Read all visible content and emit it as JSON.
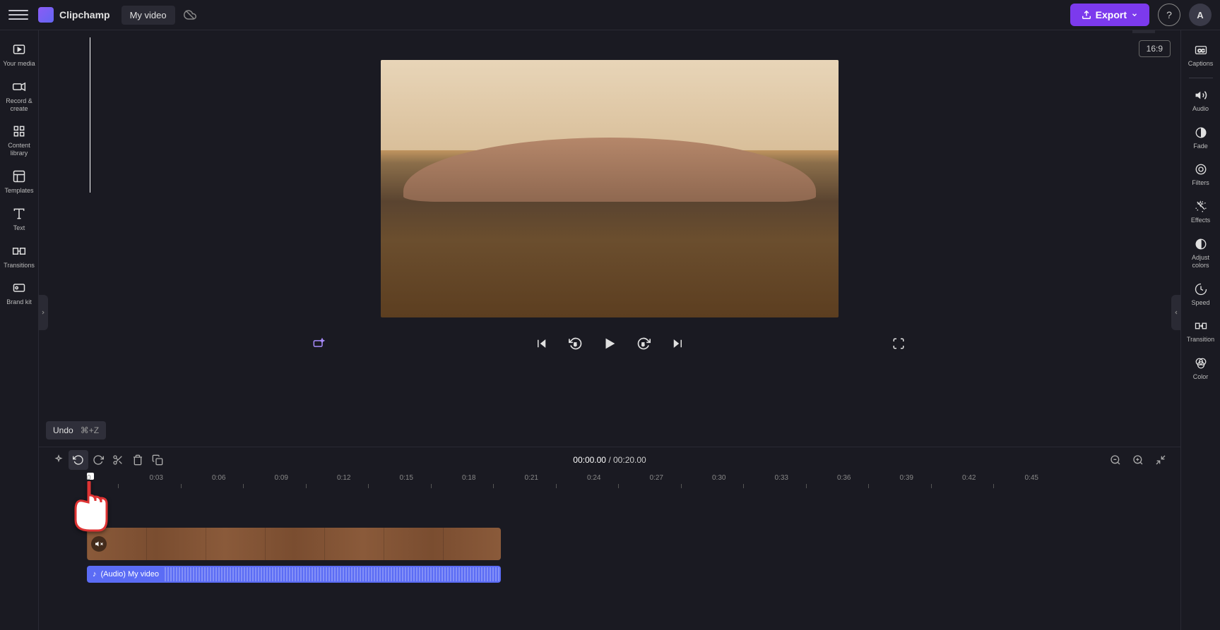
{
  "header": {
    "app_name": "Clipchamp",
    "video_title": "My video",
    "export_label": "Export",
    "avatar_initial": "A",
    "aspect_ratio": "16:9"
  },
  "left_sidebar": {
    "items": [
      {
        "label": "Your media"
      },
      {
        "label": "Record & create"
      },
      {
        "label": "Content library"
      },
      {
        "label": "Templates"
      },
      {
        "label": "Text"
      },
      {
        "label": "Transitions"
      },
      {
        "label": "Brand kit"
      }
    ]
  },
  "right_sidebar": {
    "items": [
      {
        "label": "Captions"
      },
      {
        "label": "Audio"
      },
      {
        "label": "Fade"
      },
      {
        "label": "Filters"
      },
      {
        "label": "Effects"
      },
      {
        "label": "Adjust colors"
      },
      {
        "label": "Speed"
      },
      {
        "label": "Transition"
      },
      {
        "label": "Color"
      }
    ]
  },
  "tooltip": {
    "label": "Undo",
    "shortcut": "⌘+Z"
  },
  "timeline": {
    "current_time": "00:00.00",
    "total_time": "00:20.00",
    "ruler": [
      "0",
      "0:03",
      "0:06",
      "0:09",
      "0:12",
      "0:15",
      "0:18",
      "0:21",
      "0:24",
      "0:27",
      "0:30",
      "0:33",
      "0:36",
      "0:39",
      "0:42",
      "0:45"
    ],
    "audio_clip_label": "(Audio) My video"
  }
}
